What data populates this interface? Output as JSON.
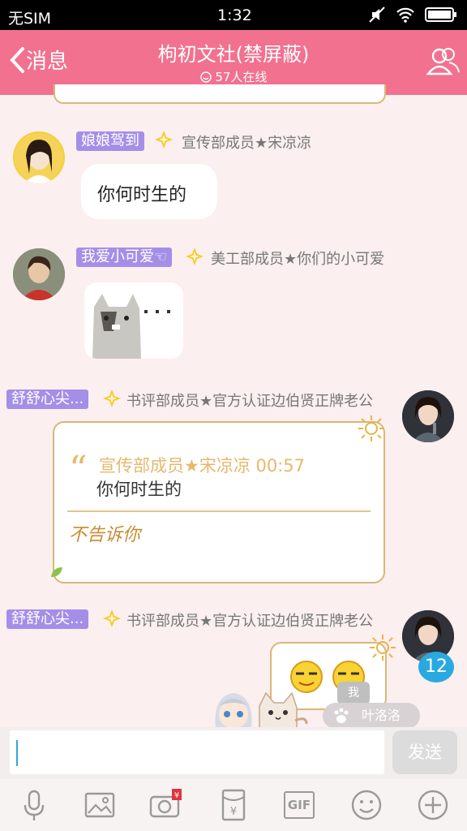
{
  "status_bar": {
    "carrier": "无SIM",
    "time": "1:32"
  },
  "header": {
    "back_label": "消息",
    "title": "枸初文社(禁屏蔽)",
    "online": "57人在线"
  },
  "messages": [
    {
      "nickname": "娘娘驾到",
      "role": "宣传部成员★宋凉凉",
      "text": "你何时生的"
    },
    {
      "nickname": "我爱小可爱☜",
      "role": "美工部成员★你们的小可爱",
      "image": "cat-sticker"
    },
    {
      "nickname": "舒舒心尖...",
      "role": "书评部成员★官方认证边伯贤正牌老公",
      "quote_meta": "宣传部成员★宋凉凉 00:57",
      "quote_text": "你何时生的",
      "reply": "不告诉你"
    },
    {
      "nickname": "舒舒心尖...",
      "role": "书评部成员★官方认证边伯贤正牌老公",
      "emoji": "smirk-faces"
    }
  ],
  "badges": {
    "unread": "12",
    "me": "我",
    "live_user": "叶洛洛"
  },
  "input": {
    "send_label": "发送"
  },
  "toolbar": {
    "gif_label": "GIF"
  },
  "colors": {
    "header": "#f2718f",
    "nickname": "#a58ee8",
    "accent": "#e6b86c"
  }
}
